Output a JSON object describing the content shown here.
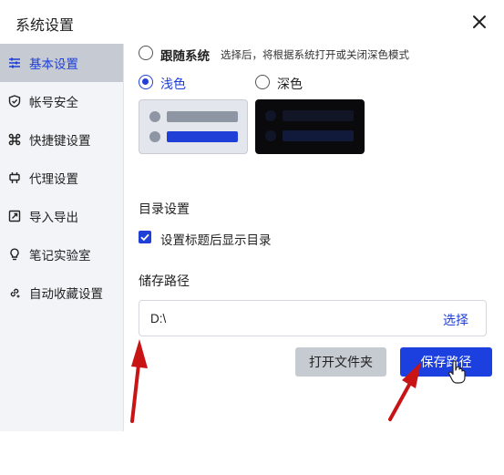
{
  "window": {
    "title": "系统设置",
    "close_icon": "close-icon"
  },
  "sidebar": {
    "items": [
      {
        "label": "基本设置",
        "icon": "sliders-icon",
        "active": true
      },
      {
        "label": "帐号安全",
        "icon": "shield-icon",
        "active": false
      },
      {
        "label": "快捷键设置",
        "icon": "command-icon",
        "active": false
      },
      {
        "label": "代理设置",
        "icon": "plug-icon",
        "active": false
      },
      {
        "label": "导入导出",
        "icon": "import-export-icon",
        "active": false
      },
      {
        "label": "笔记实验室",
        "icon": "lightbulb-icon",
        "active": false
      },
      {
        "label": "自动收藏设置",
        "icon": "link-icon",
        "active": false
      }
    ]
  },
  "appearance": {
    "follow_system_label": "跟随系统",
    "follow_system_hint": "选择后，将根据系统打开或关闭深色模式",
    "light_label": "浅色",
    "dark_label": "深色",
    "selected": "浅色"
  },
  "directory": {
    "heading": "目录设置",
    "show_toc_label": "设置标题后显示目录",
    "show_toc_checked": true
  },
  "storage": {
    "heading": "储存路径",
    "path_value": "D:\\",
    "choose_label": "选择",
    "open_folder_label": "打开文件夹",
    "save_path_label": "保存路径"
  },
  "colors": {
    "accent": "#1f3fd6",
    "save_button": "#1c3fe0",
    "annotation_arrow": "#c81414"
  }
}
